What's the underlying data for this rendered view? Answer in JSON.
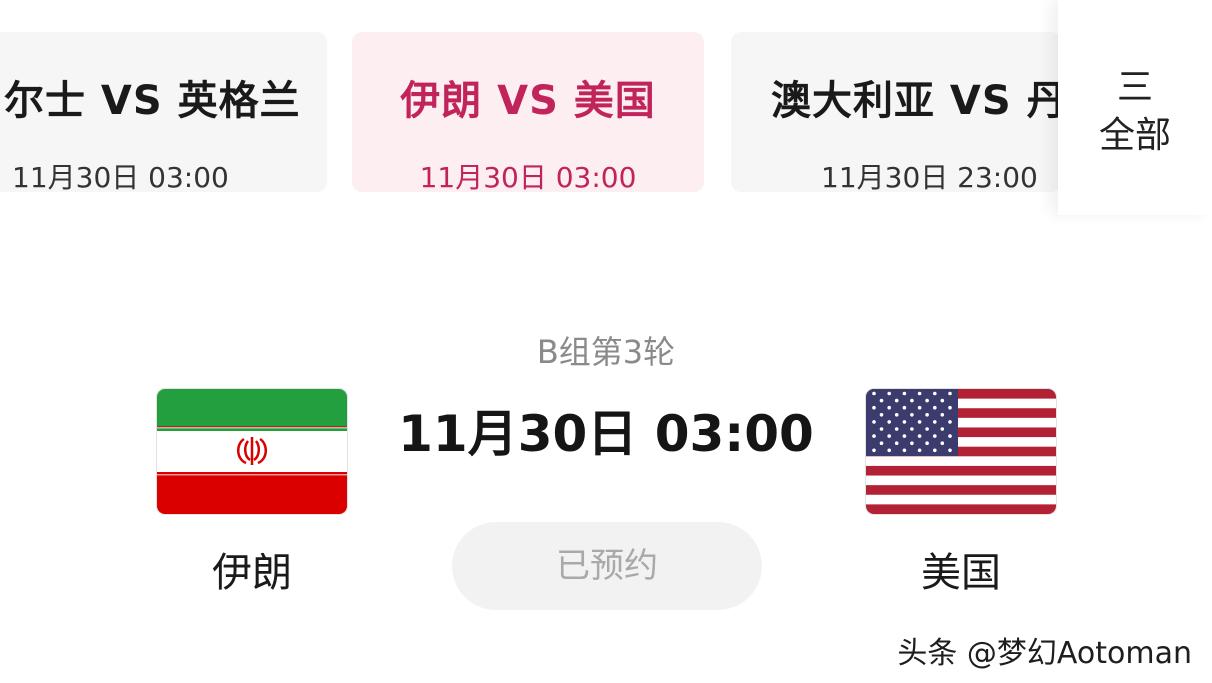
{
  "match_strip": [
    {
      "teams": "尔士 VS 英格兰",
      "time": "11月30日 03:00"
    },
    {
      "teams": "伊朗 VS 美国",
      "time": "11月30日 03:00"
    },
    {
      "teams": "澳大利亚 VS 丹",
      "time": "11月30日 23:00"
    }
  ],
  "all_button": {
    "icon": "menu-icon",
    "icon_glyph": "三",
    "label": "全部"
  },
  "detail": {
    "round": "B组第3轮",
    "time": "11月30日 03:00",
    "home_team": "伊朗",
    "away_team": "美国",
    "reserve_label": "已预约"
  },
  "colors": {
    "accent": "#c0245a",
    "active_card_bg": "#fdeef2"
  },
  "watermark": "头条 @梦幻Aotoman"
}
